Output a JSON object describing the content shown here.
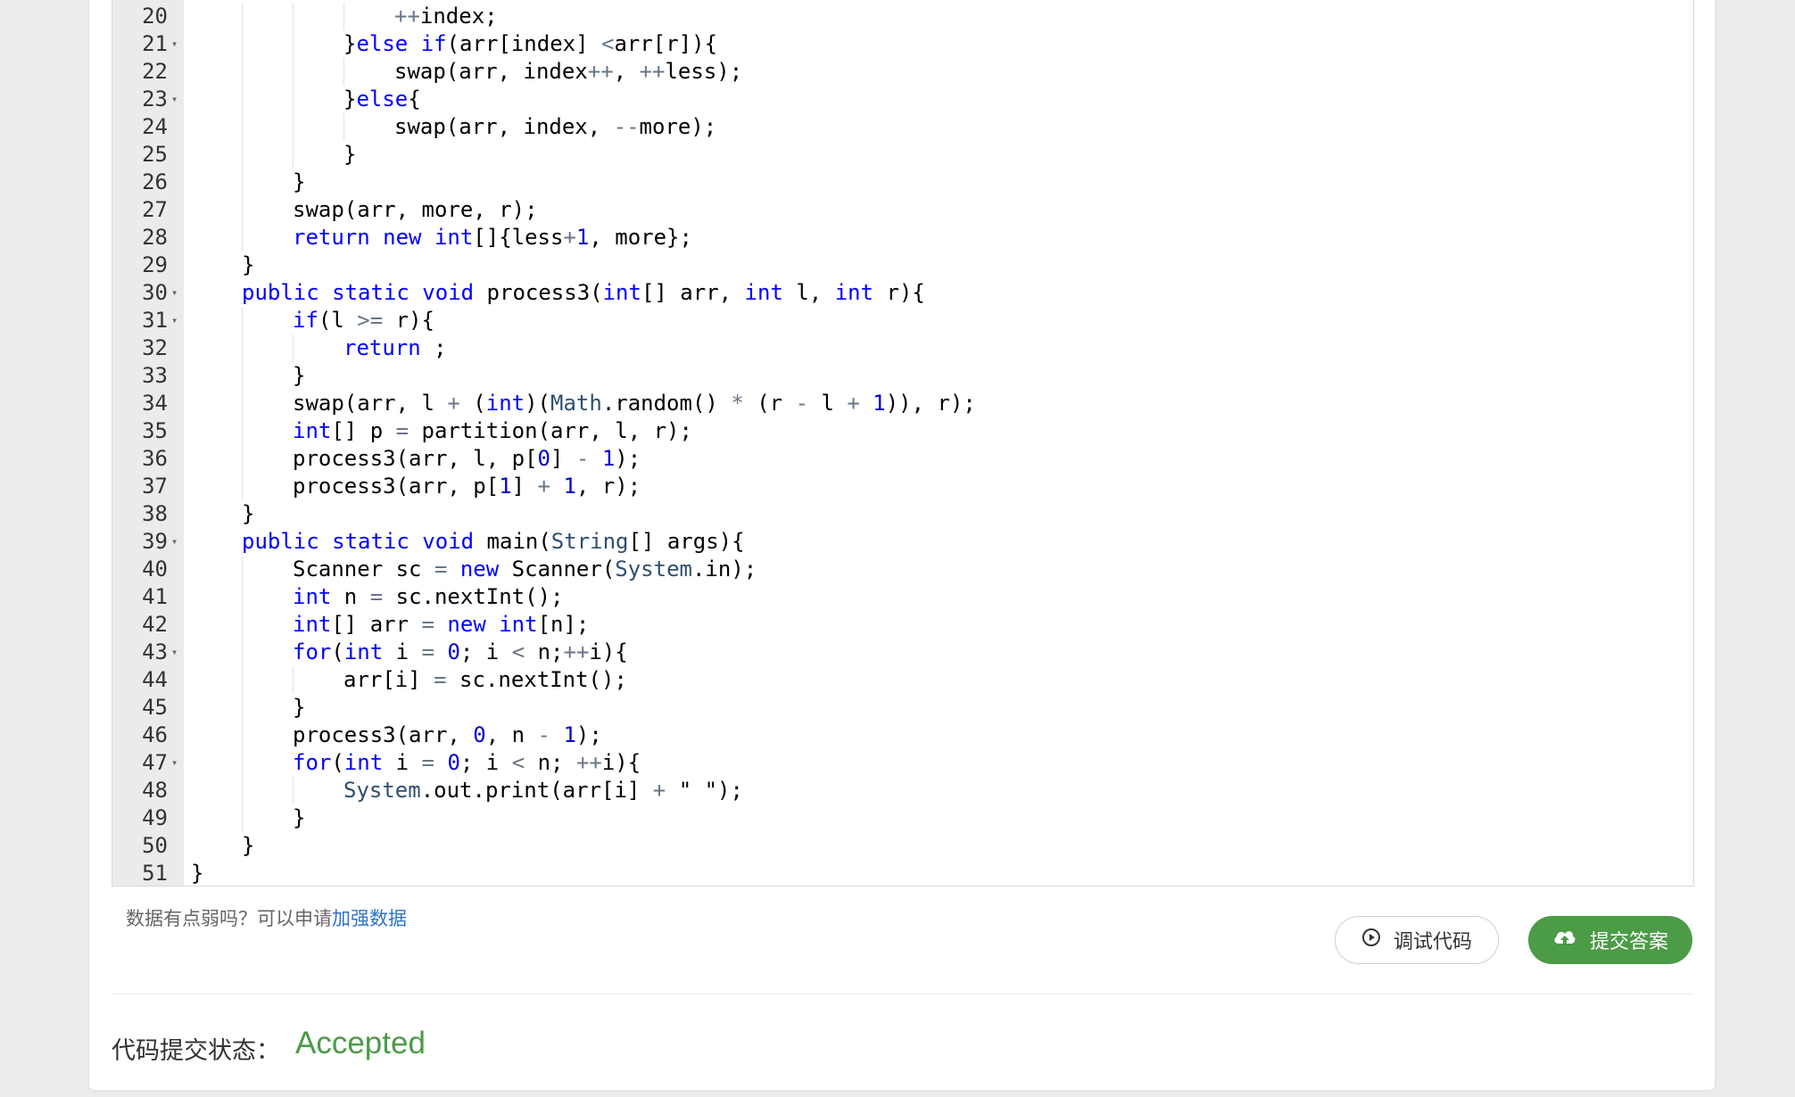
{
  "editor": {
    "lines": [
      {
        "n": "20",
        "fold": false,
        "indent": 4,
        "tokens": [
          [
            "op",
            "++"
          ],
          [
            "",
            "index;"
          ]
        ]
      },
      {
        "n": "21",
        "fold": true,
        "indent": 3,
        "tokens": [
          [
            "",
            "}"
          ],
          [
            "kw",
            "else if"
          ],
          [
            "",
            "(arr[index] "
          ],
          [
            "op",
            "<"
          ],
          [
            "",
            "arr[r]){"
          ]
        ]
      },
      {
        "n": "22",
        "fold": false,
        "indent": 4,
        "tokens": [
          [
            "",
            "swap(arr, index"
          ],
          [
            "op",
            "++"
          ],
          [
            "",
            ", "
          ],
          [
            "op",
            "++"
          ],
          [
            "",
            "less);"
          ]
        ]
      },
      {
        "n": "23",
        "fold": true,
        "indent": 3,
        "tokens": [
          [
            "",
            "}"
          ],
          [
            "kw",
            "else"
          ],
          [
            "",
            "{"
          ]
        ]
      },
      {
        "n": "24",
        "fold": false,
        "indent": 4,
        "tokens": [
          [
            "",
            "swap(arr, index, "
          ],
          [
            "op",
            "--"
          ],
          [
            "",
            "more);"
          ]
        ]
      },
      {
        "n": "25",
        "fold": false,
        "indent": 3,
        "tokens": [
          [
            "",
            "}"
          ]
        ]
      },
      {
        "n": "26",
        "fold": false,
        "indent": 2,
        "tokens": [
          [
            "",
            "}"
          ]
        ]
      },
      {
        "n": "27",
        "fold": false,
        "indent": 2,
        "tokens": [
          [
            "",
            "swap(arr, more, r);"
          ]
        ]
      },
      {
        "n": "28",
        "fold": false,
        "indent": 2,
        "tokens": [
          [
            "kw",
            "return new int"
          ],
          [
            "",
            "[]{less"
          ],
          [
            "op",
            "+"
          ],
          [
            "num",
            "1"
          ],
          [
            "",
            ", more};"
          ]
        ]
      },
      {
        "n": "29",
        "fold": false,
        "indent": 1,
        "tokens": [
          [
            "",
            "}"
          ]
        ]
      },
      {
        "n": "30",
        "fold": true,
        "indent": 1,
        "tokens": [
          [
            "kw",
            "public static void "
          ],
          [
            "",
            "process3("
          ],
          [
            "kw",
            "int"
          ],
          [
            "",
            "[] arr, "
          ],
          [
            "kw",
            "int"
          ],
          [
            "",
            " l, "
          ],
          [
            "kw",
            "int"
          ],
          [
            "",
            " r){"
          ]
        ]
      },
      {
        "n": "31",
        "fold": true,
        "indent": 2,
        "tokens": [
          [
            "kw",
            "if"
          ],
          [
            "",
            "(l "
          ],
          [
            "op",
            ">="
          ],
          [
            "",
            " r){"
          ]
        ]
      },
      {
        "n": "32",
        "fold": false,
        "indent": 3,
        "tokens": [
          [
            "kw",
            "return"
          ],
          [
            "",
            " ;"
          ]
        ]
      },
      {
        "n": "33",
        "fold": false,
        "indent": 2,
        "tokens": [
          [
            "",
            "}"
          ]
        ]
      },
      {
        "n": "34",
        "fold": false,
        "indent": 2,
        "tokens": [
          [
            "",
            "swap(arr, l "
          ],
          [
            "op",
            "+"
          ],
          [
            "",
            " ("
          ],
          [
            "kw",
            "int"
          ],
          [
            "",
            ")("
          ],
          [
            "ty",
            "Math"
          ],
          [
            "",
            ".random() "
          ],
          [
            "op",
            "*"
          ],
          [
            "",
            " (r "
          ],
          [
            "op",
            "-"
          ],
          [
            "",
            " l "
          ],
          [
            "op",
            "+"
          ],
          [
            "",
            " "
          ],
          [
            "num",
            "1"
          ],
          [
            "",
            ")), r);"
          ]
        ]
      },
      {
        "n": "35",
        "fold": false,
        "indent": 2,
        "tokens": [
          [
            "kw",
            "int"
          ],
          [
            "",
            "[] p "
          ],
          [
            "op",
            "="
          ],
          [
            "",
            " partition(arr, l, r);"
          ]
        ]
      },
      {
        "n": "36",
        "fold": false,
        "indent": 2,
        "tokens": [
          [
            "",
            "process3(arr, l, p["
          ],
          [
            "num",
            "0"
          ],
          [
            "",
            "] "
          ],
          [
            "op",
            "-"
          ],
          [
            "",
            " "
          ],
          [
            "num",
            "1"
          ],
          [
            "",
            ");"
          ]
        ]
      },
      {
        "n": "37",
        "fold": false,
        "indent": 2,
        "tokens": [
          [
            "",
            "process3(arr, p["
          ],
          [
            "num",
            "1"
          ],
          [
            "",
            "] "
          ],
          [
            "op",
            "+"
          ],
          [
            "",
            " "
          ],
          [
            "num",
            "1"
          ],
          [
            "",
            ", r);"
          ]
        ]
      },
      {
        "n": "38",
        "fold": false,
        "indent": 1,
        "tokens": [
          [
            "",
            "}"
          ]
        ]
      },
      {
        "n": "39",
        "fold": true,
        "indent": 1,
        "tokens": [
          [
            "kw",
            "public static void "
          ],
          [
            "",
            "main("
          ],
          [
            "ty",
            "String"
          ],
          [
            "",
            "[] args){"
          ]
        ]
      },
      {
        "n": "40",
        "fold": false,
        "indent": 2,
        "tokens": [
          [
            "",
            "Scanner sc "
          ],
          [
            "op",
            "="
          ],
          [
            "",
            " "
          ],
          [
            "kw",
            "new"
          ],
          [
            "",
            " Scanner("
          ],
          [
            "ty",
            "System"
          ],
          [
            "",
            ".in);"
          ]
        ]
      },
      {
        "n": "41",
        "fold": false,
        "indent": 2,
        "tokens": [
          [
            "kw",
            "int"
          ],
          [
            "",
            " n "
          ],
          [
            "op",
            "="
          ],
          [
            "",
            " sc.nextInt();"
          ]
        ]
      },
      {
        "n": "42",
        "fold": false,
        "indent": 2,
        "tokens": [
          [
            "kw",
            "int"
          ],
          [
            "",
            "[] arr "
          ],
          [
            "op",
            "="
          ],
          [
            "",
            " "
          ],
          [
            "kw",
            "new int"
          ],
          [
            "",
            "[n];"
          ]
        ]
      },
      {
        "n": "43",
        "fold": true,
        "indent": 2,
        "tokens": [
          [
            "kw",
            "for"
          ],
          [
            "",
            "("
          ],
          [
            "kw",
            "int"
          ],
          [
            "",
            " i "
          ],
          [
            "op",
            "="
          ],
          [
            "",
            " "
          ],
          [
            "num",
            "0"
          ],
          [
            "",
            "; i "
          ],
          [
            "op",
            "<"
          ],
          [
            "",
            " n;"
          ],
          [
            "op",
            "++"
          ],
          [
            "",
            "i){"
          ]
        ]
      },
      {
        "n": "44",
        "fold": false,
        "indent": 3,
        "tokens": [
          [
            "",
            "arr[i] "
          ],
          [
            "op",
            "="
          ],
          [
            "",
            " sc.nextInt();"
          ]
        ]
      },
      {
        "n": "45",
        "fold": false,
        "indent": 2,
        "tokens": [
          [
            "",
            "}"
          ]
        ]
      },
      {
        "n": "46",
        "fold": false,
        "indent": 2,
        "tokens": [
          [
            "",
            "process3(arr, "
          ],
          [
            "num",
            "0"
          ],
          [
            "",
            ", n "
          ],
          [
            "op",
            "-"
          ],
          [
            "",
            " "
          ],
          [
            "num",
            "1"
          ],
          [
            "",
            ");"
          ]
        ]
      },
      {
        "n": "47",
        "fold": true,
        "indent": 2,
        "tokens": [
          [
            "kw",
            "for"
          ],
          [
            "",
            "("
          ],
          [
            "kw",
            "int"
          ],
          [
            "",
            " i "
          ],
          [
            "op",
            "="
          ],
          [
            "",
            " "
          ],
          [
            "num",
            "0"
          ],
          [
            "",
            "; i "
          ],
          [
            "op",
            "<"
          ],
          [
            "",
            " n; "
          ],
          [
            "op",
            "++"
          ],
          [
            "",
            "i){"
          ]
        ]
      },
      {
        "n": "48",
        "fold": false,
        "indent": 3,
        "tokens": [
          [
            "ty",
            "System"
          ],
          [
            "",
            ".out.print(arr[i] "
          ],
          [
            "op",
            "+"
          ],
          [
            "",
            " \" \");"
          ]
        ]
      },
      {
        "n": "49",
        "fold": false,
        "indent": 2,
        "tokens": [
          [
            "",
            "}"
          ]
        ]
      },
      {
        "n": "50",
        "fold": false,
        "indent": 1,
        "tokens": [
          [
            "",
            "}"
          ]
        ]
      },
      {
        "n": "51",
        "fold": false,
        "indent": 0,
        "tokens": [
          [
            "",
            "}"
          ]
        ]
      }
    ]
  },
  "hint": {
    "text": "数据有点弱吗？可以申请",
    "link": "加强数据"
  },
  "buttons": {
    "debug_label": "调试代码",
    "submit_label": "提交答案"
  },
  "status": {
    "label": "代码提交状态：",
    "value": "Accepted",
    "value_color": "#4b9b47"
  }
}
